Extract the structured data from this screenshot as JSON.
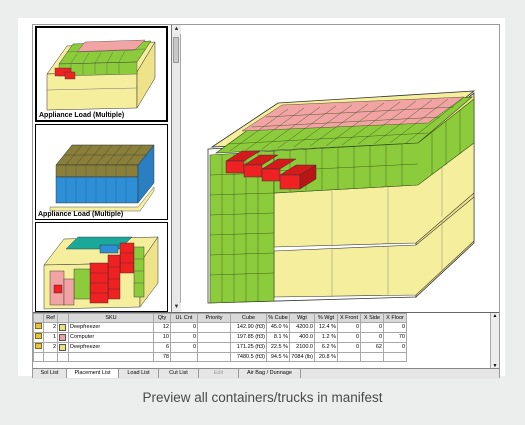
{
  "thumbnails": [
    {
      "label": "Appliance Load (Multiple)",
      "selected": true
    },
    {
      "label": "Appliance Load (Multiple)",
      "selected": false
    },
    {
      "label": "",
      "selected": false
    }
  ],
  "grid": {
    "columns": [
      "",
      "Ref",
      "",
      "SKU",
      "Qty",
      "UL Cnt",
      "Priority",
      "Cube",
      "% Cube",
      "Wgt",
      "% Wgt",
      "X Front",
      "X Side",
      "X Floor"
    ],
    "rows": [
      {
        "color": "#e8e27a",
        "ref": "2",
        "sku": "Deepfreezer",
        "qty": "12",
        "ul": "0",
        "priority": "",
        "cube": "142.90 (ft3)",
        "pcube": "45.0 %",
        "wgt": "4200.0",
        "pwgt": "12.4 %",
        "xfront": "0",
        "xside": "0",
        "xfloor": "0"
      },
      {
        "color": "#f0a0a8",
        "ref": "1",
        "sku": "Computer",
        "qty": "10",
        "ul": "0",
        "priority": "",
        "cube": "197.85 (ft3)",
        "pcube": "8.1 %",
        "wgt": "400.0",
        "pwgt": "1.2 %",
        "xfront": "0",
        "xside": "0",
        "xfloor": "70"
      },
      {
        "color": "#e8e27a",
        "ref": "2",
        "sku": "Deepfreezer",
        "qty": "6",
        "ul": "0",
        "priority": "",
        "cube": "171.25 (ft3)",
        "pcube": "22.5 %",
        "wgt": "2100.0",
        "pwgt": "6.2 %",
        "xfront": "0",
        "xside": "62",
        "xfloor": "0"
      },
      {
        "color": "",
        "ref": "",
        "sku": "",
        "qty": "78",
        "ul": "",
        "priority": "",
        "cube": "7480.5 (ft3)",
        "pcube": "94.5 %",
        "wgt": "7084 (lb)",
        "pwgt": "20.8 %",
        "xfront": "",
        "xside": "",
        "xfloor": ""
      }
    ]
  },
  "tabs": [
    {
      "label": "Sol List",
      "state": "normal"
    },
    {
      "label": "Placement List",
      "state": "active"
    },
    {
      "label": "Load List",
      "state": "normal"
    },
    {
      "label": "Cut List",
      "state": "normal"
    },
    {
      "label": "Edit",
      "state": "disabled"
    },
    {
      "label": "Air Bag / Dunnage",
      "state": "normal"
    }
  ],
  "caption": "Preview all containers/trucks in manifest",
  "colors": {
    "green": "#8ccc3c",
    "yellow": "#f5ee9c",
    "pink": "#f2a3a3",
    "red": "#ee2222",
    "olive": "#8a7f3a",
    "blue": "#2e8fd6",
    "teal": "#1aa89a"
  }
}
